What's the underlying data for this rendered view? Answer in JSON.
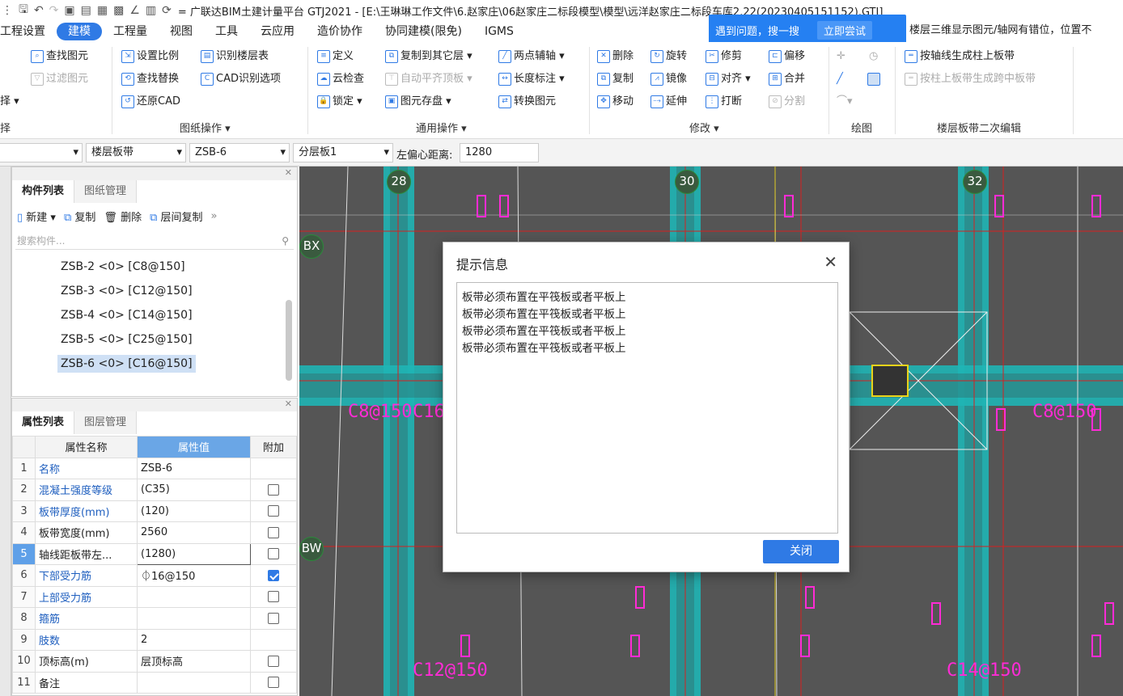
{
  "window": {
    "title": "= 广联达BIM土建计量平台 GTJ2021 - [E:\\王琳琳工作文件\\6.赵家庄\\06赵家庄二标段模型\\模型\\远洋赵家庄二标段车库2.22(20230405151152).GTJ]"
  },
  "menu": {
    "items": [
      "工程设置",
      "建模",
      "工程量",
      "视图",
      "工具",
      "云应用",
      "造价协作",
      "协同建模(限免)",
      "IGMS"
    ],
    "active": "建模"
  },
  "notification": {
    "text": "遇到问题，搜一搜",
    "button": "立即尝试",
    "extra": "楼层三维显示图元/轴网有错位，位置不"
  },
  "ribbon": {
    "select_group": {
      "btn1": "查找图元",
      "btn2": "过滤图元",
      "btn3": "择 ▾",
      "label": "择"
    },
    "drawing_ops": {
      "label": "图纸操作 ▾",
      "buttons": [
        "设置比例",
        "识别楼层表",
        "查找替换",
        "CAD识别选项",
        "还原CAD"
      ]
    },
    "general_ops": {
      "label": "通用操作 ▾",
      "buttons": [
        "定义",
        "复制到其它层 ▾",
        "两点辅轴 ▾",
        "云检查",
        "自动平齐顶板 ▾",
        "长度标注 ▾",
        "锁定 ▾",
        "图元存盘 ▾",
        "转换图元"
      ]
    },
    "modify": {
      "label": "修改 ▾",
      "buttons": [
        "删除",
        "旋转",
        "修剪",
        "偏移",
        "复制",
        "镜像",
        "对齐 ▾",
        "合并",
        "移动",
        "延伸",
        "打断",
        "分割"
      ]
    },
    "draw": {
      "label": "绘图"
    },
    "band_edit": {
      "label": "楼层板带二次编辑",
      "buttons": [
        "按轴线生成柱上板带",
        "按柱上板带生成跨中板带"
      ]
    }
  },
  "prop_toolbar": {
    "combo1": "楼层板带",
    "combo2": "ZSB-6",
    "combo3": "分层板1",
    "offset_label": "左偏心距离:",
    "offset_value": "1280"
  },
  "component_panel": {
    "tabs": [
      "构件列表",
      "图纸管理"
    ],
    "toolbar": [
      "新建 ▾",
      "复制",
      "删除",
      "层间复制"
    ],
    "search_placeholder": "搜索构件...",
    "items": [
      "ZSB-2 <0> [C8@150]",
      "ZSB-3 <0> [C12@150]",
      "ZSB-4 <0> [C14@150]",
      "ZSB-5 <0> [C25@150]",
      "ZSB-6 <0> [C16@150]"
    ],
    "selected_index": 4
  },
  "attribute_panel": {
    "tabs": [
      "属性列表",
      "图层管理"
    ],
    "headers": [
      "属性名称",
      "属性值",
      "附加"
    ],
    "rows": [
      {
        "no": "1",
        "name": "名称",
        "value": "ZSB-6",
        "blue": true,
        "check": null
      },
      {
        "no": "2",
        "name": "混凝土强度等级",
        "value": "(C35)",
        "blue": true,
        "check": false
      },
      {
        "no": "3",
        "name": "板带厚度(mm)",
        "value": "(120)",
        "blue": true,
        "check": false
      },
      {
        "no": "4",
        "name": "板带宽度(mm)",
        "value": "2560",
        "blue": false,
        "check": false
      },
      {
        "no": "5",
        "name": "轴线距板带左...",
        "value": "(1280)",
        "blue": false,
        "check": false,
        "selected": true
      },
      {
        "no": "6",
        "name": "下部受力筋",
        "value": "⏀16@150",
        "blue": true,
        "check": true
      },
      {
        "no": "7",
        "name": "上部受力筋",
        "value": "",
        "blue": true,
        "check": false
      },
      {
        "no": "8",
        "name": "箍筋",
        "value": "",
        "blue": true,
        "check": false
      },
      {
        "no": "9",
        "name": "肢数",
        "value": "2",
        "blue": true,
        "check": null
      },
      {
        "no": "10",
        "name": "顶标高(m)",
        "value": "层顶标高",
        "blue": false,
        "check": false
      },
      {
        "no": "11",
        "name": "备注",
        "value": "",
        "blue": false,
        "check": false
      }
    ]
  },
  "canvas": {
    "axis_labels": [
      "28",
      "30",
      "32",
      "BX",
      "BW"
    ],
    "annotations": [
      "C8@150",
      "C16@150",
      "C12@150",
      "C14@150"
    ]
  },
  "dialog": {
    "title": "提示信息",
    "lines": [
      "板带必须布置在平筏板或者平板上",
      "板带必须布置在平筏板或者平板上",
      "板带必须布置在平筏板或者平板上",
      "板带必须布置在平筏板或者平板上"
    ],
    "close_button": "关闭"
  },
  "colors": {
    "accent": "#2f7ae5",
    "canvas_bg": "#555555",
    "band_teal": "#1fb5b5",
    "axis_red": "#d62020",
    "annotation_magenta": "#ff2bd6"
  }
}
